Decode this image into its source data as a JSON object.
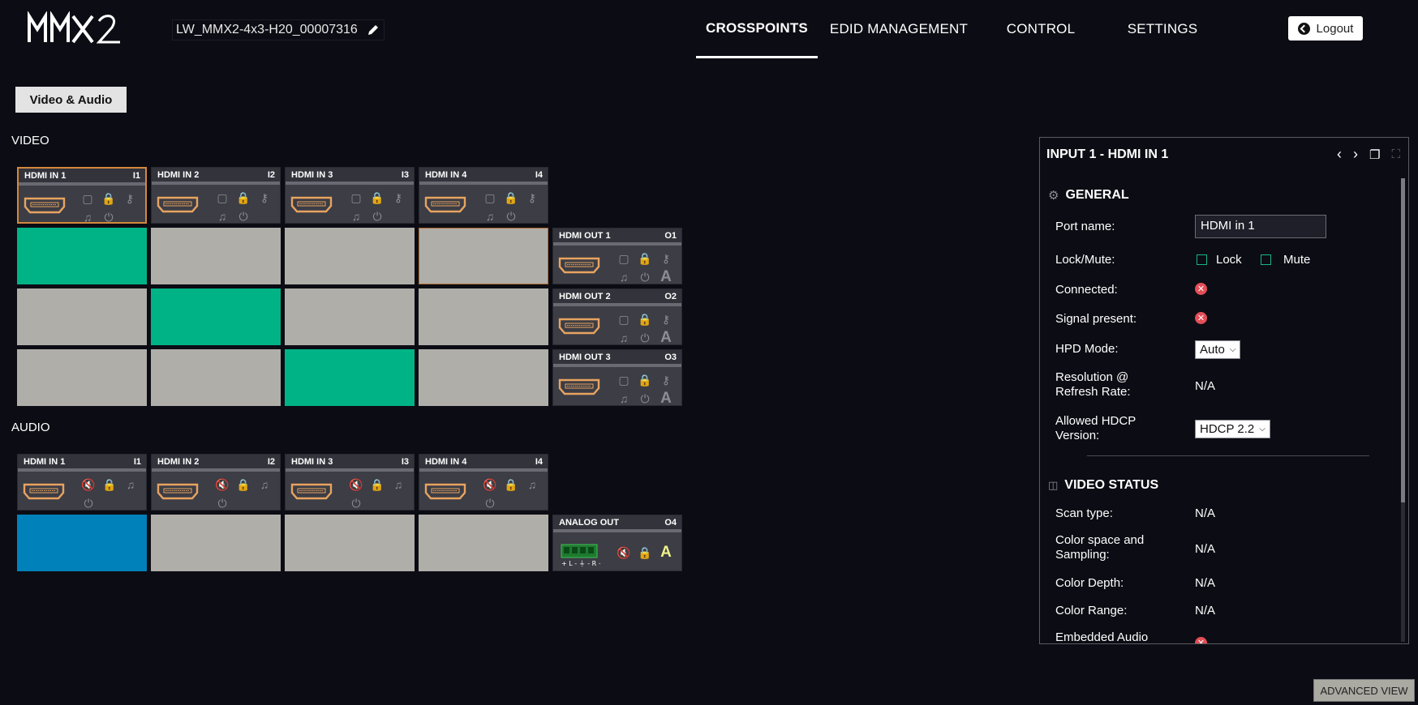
{
  "header": {
    "logo_text": "MMX2",
    "device_name": "LW_MMX2-4x3-H20_00007316",
    "nav": [
      {
        "label": "CROSSPOINTS",
        "active": true
      },
      {
        "label": "EDID MANAGEMENT",
        "active": false
      },
      {
        "label": "CONTROL",
        "active": false
      },
      {
        "label": "SETTINGS",
        "active": false
      }
    ],
    "logout_label": "Logout"
  },
  "subtab": {
    "label": "Video & Audio"
  },
  "video": {
    "section_label": "VIDEO",
    "inputs": [
      {
        "name": "HDMI IN 1",
        "id": "I1",
        "selected": true
      },
      {
        "name": "HDMI IN 2",
        "id": "I2",
        "selected": false
      },
      {
        "name": "HDMI IN 3",
        "id": "I3",
        "selected": false
      },
      {
        "name": "HDMI IN 4",
        "id": "I4",
        "selected": false
      }
    ],
    "outputs": [
      {
        "name": "HDMI OUT 1",
        "id": "O1",
        "auto_label": "A"
      },
      {
        "name": "HDMI OUT 2",
        "id": "O2",
        "auto_label": "A"
      },
      {
        "name": "HDMI OUT 3",
        "id": "O3",
        "auto_label": "A"
      }
    ],
    "crosspoints": [
      [
        true,
        false,
        false,
        false
      ],
      [
        false,
        true,
        false,
        false
      ],
      [
        false,
        false,
        true,
        false
      ]
    ]
  },
  "audio": {
    "section_label": "AUDIO",
    "inputs": [
      {
        "name": "HDMI IN 1",
        "id": "I1"
      },
      {
        "name": "HDMI IN 2",
        "id": "I2"
      },
      {
        "name": "HDMI IN 3",
        "id": "I3"
      },
      {
        "name": "HDMI IN 4",
        "id": "I4"
      }
    ],
    "outputs": [
      {
        "name": "ANALOG OUT",
        "id": "O4",
        "auto_label": "A"
      }
    ],
    "crosspoints": [
      [
        true,
        false,
        false,
        false
      ]
    ]
  },
  "colors": {
    "video_active": "#00b387",
    "audio_active": "#0081b9",
    "inactive": "#b0aea8",
    "selected_border": "#d4883e"
  },
  "panel": {
    "title": "INPUT 1 - HDMI IN 1",
    "general": {
      "heading": "GENERAL",
      "port_name_label": "Port name:",
      "port_name_value": "HDMI in 1",
      "lockmute_label": "Lock/Mute:",
      "lock_label": "Lock",
      "mute_label": "Mute",
      "connected_label": "Connected:",
      "signal_label": "Signal present:",
      "hpd_label": "HPD Mode:",
      "hpd_value": "Auto",
      "resolution_label_1": "Resolution @",
      "resolution_label_2": "Refresh Rate:",
      "resolution_value": "N/A",
      "hdcp_label_1": "Allowed HDCP",
      "hdcp_label_2": "Version:",
      "hdcp_value": "HDCP 2.2"
    },
    "video_status": {
      "heading": "VIDEO STATUS",
      "scan_label": "Scan type:",
      "scan_value": "N/A",
      "colorspace_label_1": "Color space and",
      "colorspace_label_2": "Sampling:",
      "colorspace_value": "N/A",
      "depth_label": "Color Depth:",
      "depth_value": "N/A",
      "range_label": "Color Range:",
      "range_value": "N/A",
      "embedded_label": "Embedded Audio"
    }
  },
  "advanced_view_label": "ADVANCED VIEW"
}
